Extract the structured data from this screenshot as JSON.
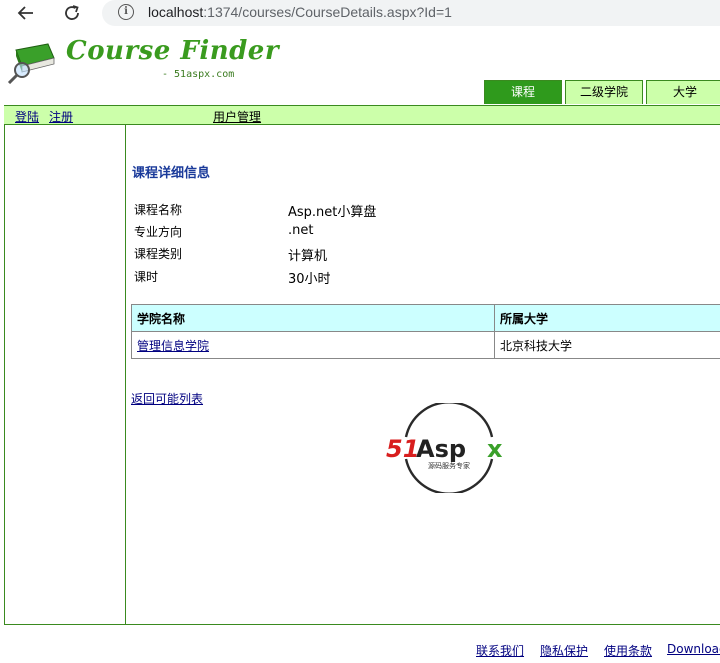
{
  "browser": {
    "url_host": "localhost",
    "url_path": ":1374/courses/CourseDetails.aspx?Id=1",
    "info_icon": "info-icon",
    "back_icon": "arrow-left-icon",
    "reload_icon": "reload-icon"
  },
  "header": {
    "logo_title": "Course Finder",
    "logo_subtitle": "- 51aspx.com",
    "logo_icon": "book-magnifier-icon"
  },
  "tabs": [
    {
      "label": "课程",
      "active": true
    },
    {
      "label": "二级学院",
      "active": false
    },
    {
      "label": "大学",
      "active": false
    }
  ],
  "topnav": {
    "login": "登陆",
    "register": "注册",
    "user_management": "用户管理"
  },
  "details": {
    "title": "课程详细信息",
    "rows": [
      {
        "label": "课程名称",
        "value": "Asp.net小算盘"
      },
      {
        "label": "专业方向",
        "value": ".net"
      },
      {
        "label": "课程类别",
        "value": "计算机"
      },
      {
        "label": "课时",
        "value": "30小时"
      }
    ]
  },
  "college_table": {
    "headers": [
      "学院名称",
      "所属大学"
    ],
    "rows": [
      {
        "college": "管理信息学院",
        "university": "北京科技大学"
      }
    ]
  },
  "back_link": "返回可能列表",
  "watermark": {
    "brand_red": "51",
    "brand_dark": "Asp",
    "brand_green": "x",
    "tagline": "源码服务专家",
    "colors": {
      "red": "#d81e1e",
      "dark": "#222222",
      "green": "#3aa02a"
    }
  },
  "footer": {
    "contact": "联系我们",
    "privacy": "隐私保护",
    "terms": "使用条款",
    "download": "Download"
  },
  "colors": {
    "brand_green": "#2f9a1c",
    "light_green": "#ccffaa",
    "table_header": "#ccffff",
    "link_blue": "#000080",
    "title_blue": "#1a3a9a"
  }
}
